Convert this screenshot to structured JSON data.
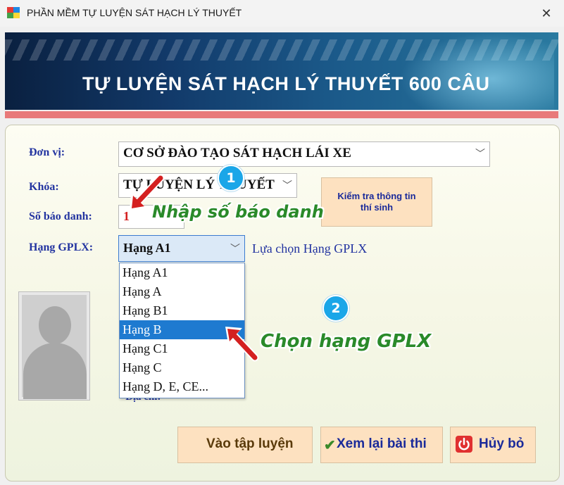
{
  "window": {
    "title": "PHẦN MỀM TỰ LUYỆN SÁT HẠCH LÝ THUYẾT",
    "close_symbol": "✕"
  },
  "banner": {
    "heading": "TỰ LUYỆN SÁT HẠCH LÝ THUYẾT 600 CÂU"
  },
  "form": {
    "don_vi_label": "Đơn vị:",
    "don_vi_value": "CƠ SỞ ĐÀO TẠO SÁT HẠCH LÁI XE",
    "khoa_label": "Khóa:",
    "khoa_value": "TỰ LUYỆN LÝ THUYẾT",
    "so_bao_danh_label": "Số báo danh:",
    "so_bao_danh_value": "1",
    "hang_label": "Hạng GPLX:",
    "hang_value": "Hạng A1",
    "hang_hint": "Lựa chọn Hạng GPLX",
    "dia_chi_label": "Địa chỉ:",
    "check_button": "Kiểm tra thông tin thí sinh"
  },
  "dropdown": {
    "options": [
      "Hạng A1",
      "Hạng A",
      "Hạng B1",
      "Hạng B",
      "Hạng C1",
      "Hạng C",
      "Hạng D, E, CE..."
    ],
    "highlighted": "Hạng B"
  },
  "buttons": {
    "start": "Vào tập luyện",
    "review": "Xem lại bài thi",
    "cancel": "Hủy bỏ"
  },
  "annotations": {
    "step1_number": "1",
    "step1_text": "Nhập số báo danh",
    "step2_number": "2",
    "step2_text": "Chọn hạng GPLX"
  },
  "colors": {
    "label_blue": "#2233a0",
    "button_peach": "#fde1c0",
    "highlight": "#1e7ad0",
    "annotation_green": "#2a8a2a",
    "step_badge": "#1aa6e8",
    "arrow_red": "#d42020"
  },
  "icons": {
    "review": "check-icon",
    "cancel": "power-icon"
  }
}
